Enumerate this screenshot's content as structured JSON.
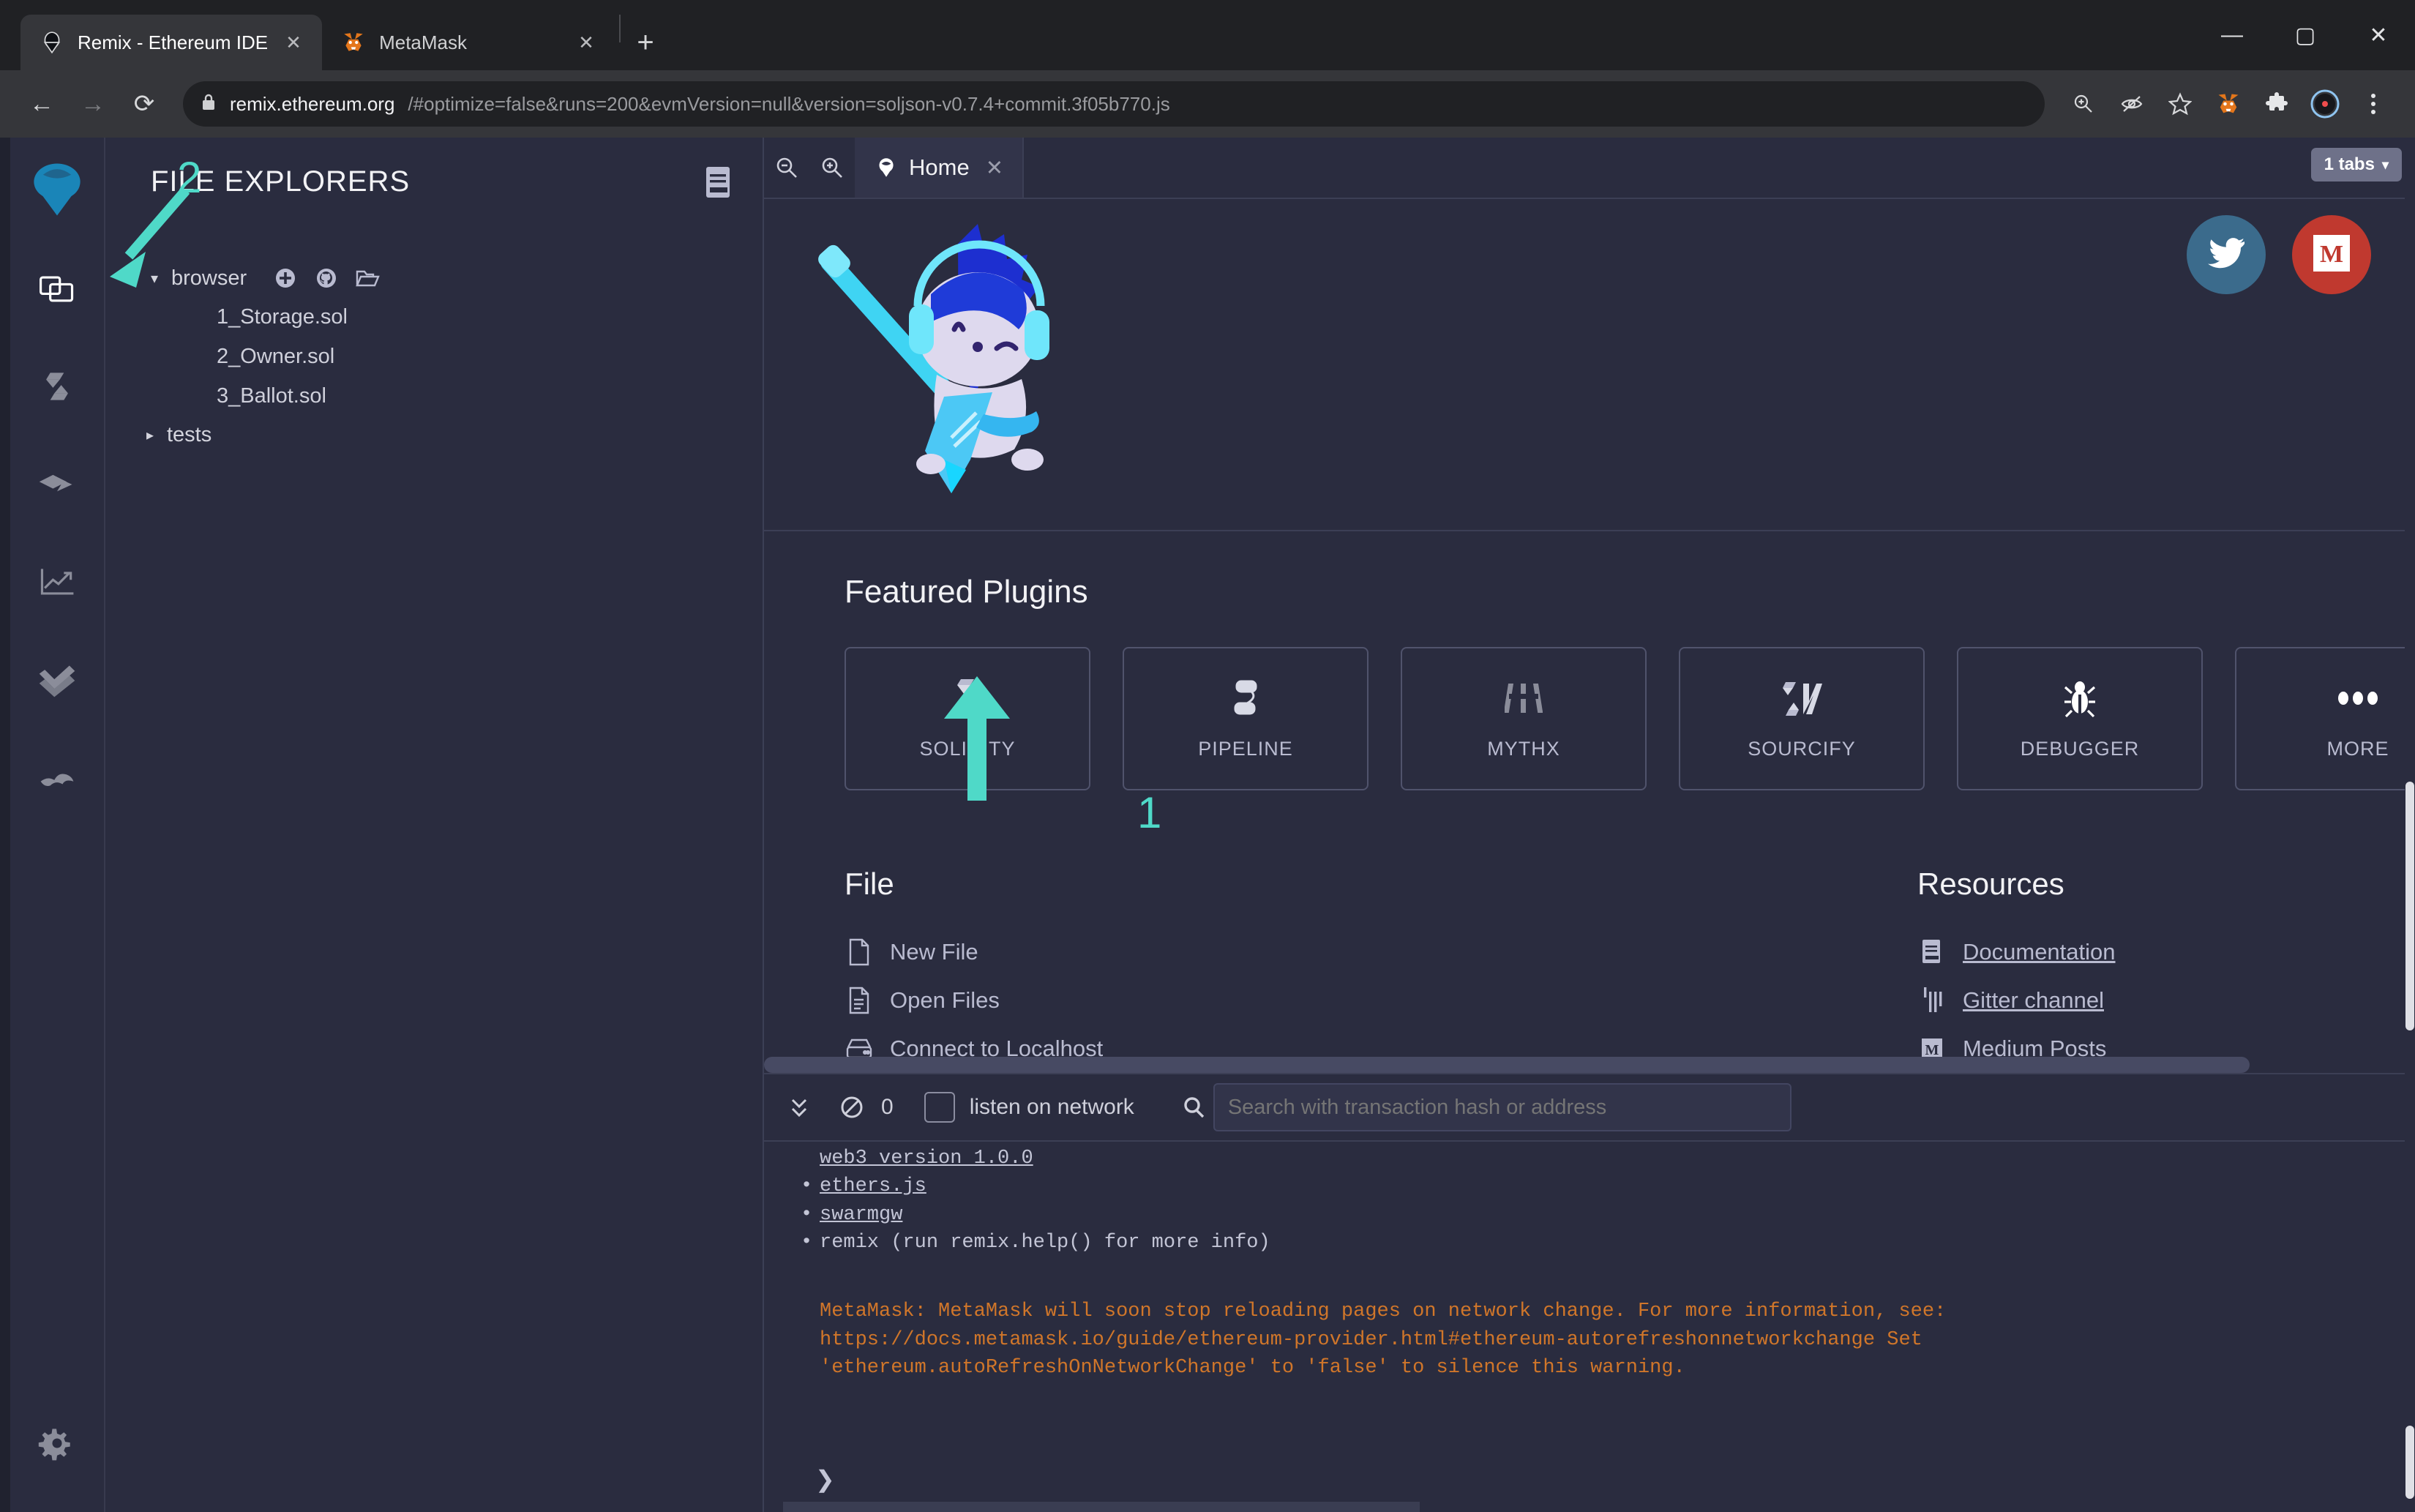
{
  "browser": {
    "tabs": [
      {
        "title": "Remix - Ethereum IDE",
        "favicon": "remix-logo-icon",
        "active": true,
        "close_label": "✕"
      },
      {
        "title": "MetaMask",
        "favicon": "metamask-fox-icon",
        "active": false,
        "close_label": "✕"
      }
    ],
    "new_tab_label": "+",
    "window_controls": {
      "minimize": "—",
      "maximize": "▢",
      "close": "✕"
    },
    "nav": {
      "back": "←",
      "forward": "→",
      "reload": "⟳"
    },
    "omnibox": {
      "lock": "🔒",
      "host": "remix.ethereum.org",
      "path": "/#optimize=false&runs=200&evmVersion=null&version=soljson-v0.7.4+commit.3f05b770.js",
      "full_url": "remix.ethereum.org/#optimize=false&runs=200&evmVersion=null&version=soljson-v0.7.4+commit.3f05b770.js"
    },
    "toolbar_icons": [
      "zoom-in-icon",
      "eye-slash-icon",
      "star-icon",
      "metamask-extension-icon",
      "puzzle-extensions-icon",
      "profile-avatar-icon",
      "chrome-menu-icon"
    ]
  },
  "sidebar": {
    "logo": "remix-logo-icon",
    "items": [
      {
        "name": "file-explorers",
        "icon": "files-icon",
        "active": true
      },
      {
        "name": "solidity-compiler",
        "icon": "solidity-icon",
        "active": false
      },
      {
        "name": "deploy-and-run",
        "icon": "deploy-run-icon",
        "active": false
      },
      {
        "name": "analysis",
        "icon": "chart-line-icon",
        "active": false
      },
      {
        "name": "testing",
        "icon": "double-check-icon",
        "active": false
      },
      {
        "name": "plugin-manager",
        "icon": "plug-icon",
        "active": false
      }
    ],
    "settings": {
      "name": "settings",
      "icon": "gear-icon"
    }
  },
  "explorer": {
    "title": "FILE EXPLORERS",
    "header_icon": "documentation-book-icon",
    "root": {
      "caret": "▾",
      "label": "browser",
      "actions": [
        "add-file-icon",
        "github-icon",
        "open-folder-icon"
      ]
    },
    "files": [
      "1_Storage.sol",
      "2_Owner.sol",
      "3_Ballot.sol"
    ],
    "folders": [
      {
        "caret": "▸",
        "label": "tests"
      }
    ]
  },
  "annotations": [
    {
      "id": "1",
      "label": "1",
      "target": "solidity-plugin-card"
    },
    {
      "id": "2",
      "label": "2",
      "target": "file-explorers-sidebar-icon"
    }
  ],
  "editor_tabs": {
    "zoom_out": "zoom-out-icon",
    "zoom_in": "zoom-in-icon",
    "tabs": [
      {
        "label": "Home",
        "icon": "remix-logo-icon",
        "close": "✕",
        "active": true
      }
    ],
    "tabs_badge": {
      "label": "1 tabs",
      "caret": "▾"
    }
  },
  "home": {
    "mascot_alt": "remix-mascot-icon",
    "socials": [
      {
        "name": "twitter",
        "glyph": "twitter-bird-icon",
        "color": "#3b6b8c"
      },
      {
        "name": "medium",
        "glyph": "medium-m-icon",
        "color": "#c0392f"
      }
    ],
    "featured_plugins_title": "Featured Plugins",
    "plugins": [
      {
        "label": "SOLIDITY",
        "icon": "solidity-icon"
      },
      {
        "label": "PIPELINE",
        "icon": "pipeline-icon"
      },
      {
        "label": "MYTHX",
        "icon": "mythx-icon"
      },
      {
        "label": "SOURCIFY",
        "icon": "sourcify-icon"
      },
      {
        "label": "DEBUGGER",
        "icon": "bug-icon"
      },
      {
        "label": "MORE",
        "icon": "ellipsis-icon"
      }
    ],
    "file_section": {
      "title": "File",
      "items": [
        {
          "label": "New File",
          "icon": "new-file-icon"
        },
        {
          "label": "Open Files",
          "icon": "open-files-icon"
        },
        {
          "label": "Connect to Localhost",
          "icon": "localhost-icon"
        }
      ]
    },
    "resources_section": {
      "title": "Resources",
      "items": [
        {
          "label": "Documentation",
          "icon": "book-icon"
        },
        {
          "label": "Gitter channel",
          "icon": "gitter-icon"
        },
        {
          "label": "Medium Posts",
          "icon": "medium-m-icon"
        }
      ]
    }
  },
  "terminal": {
    "toolbar": {
      "collapse_icon": "chevron-double-down-icon",
      "clear_icon": "no-entry-icon",
      "pending_count": "0",
      "listen_checkbox_label": "listen on network",
      "listen_checked": false,
      "search_icon": "search-icon",
      "search_placeholder": "Search with transaction hash or address",
      "search_value": ""
    },
    "log": {
      "clipped_first_line": "web3 version 1.0.0",
      "items": [
        {
          "text": "ethers.js",
          "link": true
        },
        {
          "text": "swarmgw",
          "link": true
        },
        {
          "text": "remix (run remix.help() for more info)",
          "link": false
        }
      ],
      "warning": "MetaMask: MetaMask will soon stop reloading pages on network change. For more information, see: https://docs.metamask.io/guide/ethereum-provider.html#ethereum-autorefreshonnetworkchange Set 'ethereum.autoRefreshOnNetworkChange' to 'false' to silence this warning.",
      "warning_color": "#d0762a"
    },
    "prompt": "❯"
  },
  "colors": {
    "app_bg": "#2a2c3f",
    "panel_border": "#3c3f55",
    "accent_annotation": "#4fd9c8",
    "text_primary": "#f2f2f5",
    "text_muted": "#b9bbd0",
    "browser_chrome": "#35363a",
    "browser_titlebar": "#202124"
  }
}
